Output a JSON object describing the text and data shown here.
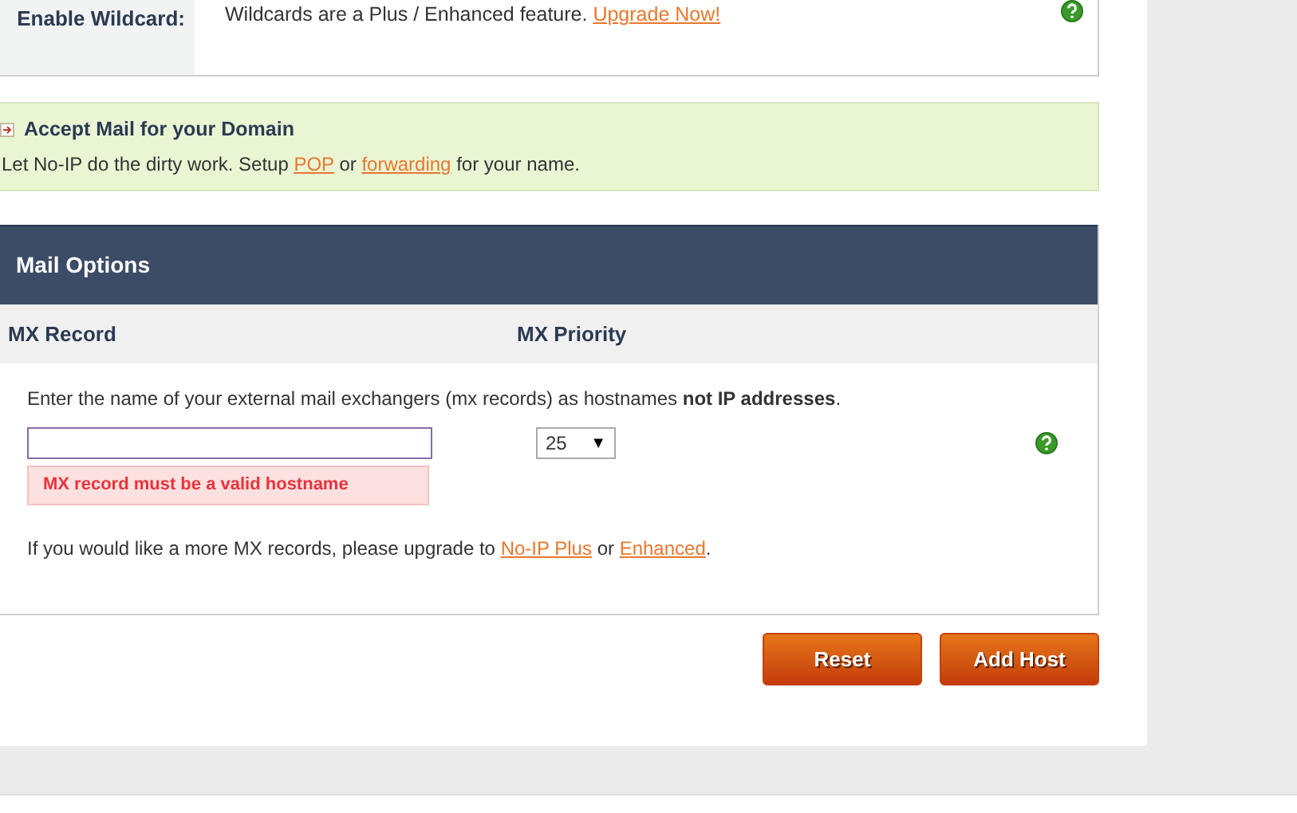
{
  "wildcard": {
    "label": "Enable Wildcard:",
    "text": "Wildcards are a Plus / Enhanced feature.",
    "link": "Upgrade Now!"
  },
  "mail_promo": {
    "title": "Accept Mail for your Domain",
    "text_before": "Let No-IP do the dirty work. Setup",
    "link_1": "POP",
    "text_middle": "or",
    "link_2": "forwarding",
    "text_after": "for your name."
  },
  "mail_options": {
    "title": "Mail Options",
    "columns": [
      "MX Record",
      "MX Priority"
    ],
    "instructions": "Enter the name of your external mail exchangers (mx records) as hostnames **not IP addresses**.",
    "mx_record": {
      "error": "MX record must be a valid hostname"
    },
    "priority": {
      "value": "25",
      "arrow": "▼"
    },
    "upgrade": {
      "text_before": "If you would like a more MX records, please upgrade to",
      "link_1": "No-IP Plus",
      "text_middle": "or",
      "link_2": "Enhanced",
      "text_after": "."
    }
  },
  "buttons": [
    "Reset",
    "Add Host"
  ]
}
